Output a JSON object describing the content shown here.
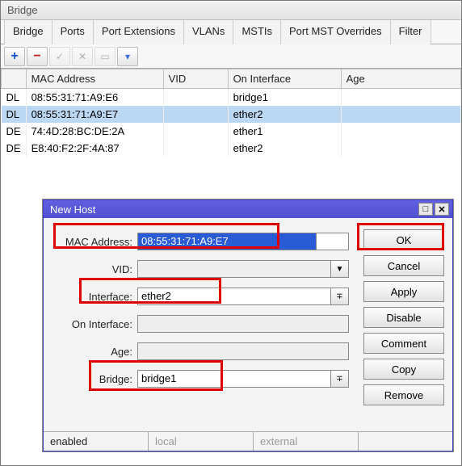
{
  "window": {
    "title": "Bridge"
  },
  "tabs": [
    "Bridge",
    "Ports",
    "Port Extensions",
    "VLANs",
    "MSTIs",
    "Port MST Overrides",
    "Filter"
  ],
  "columns": {
    "flag": "",
    "mac": "MAC Address",
    "vid": "VID",
    "oni": "On Interface",
    "age": "Age"
  },
  "rows": [
    {
      "flag": "DL",
      "mac": "08:55:31:71:A9:E6",
      "vid": "",
      "oni": "bridge1",
      "age": ""
    },
    {
      "flag": "DL",
      "mac": "08:55:31:71:A9:E7",
      "vid": "",
      "oni": "ether2",
      "age": ""
    },
    {
      "flag": "DE",
      "mac": "74:4D:28:BC:DE:2A",
      "vid": "",
      "oni": "ether1",
      "age": ""
    },
    {
      "flag": "DE",
      "mac": "E8:40:F2:2F:4A:87",
      "vid": "",
      "oni": "ether2",
      "age": ""
    }
  ],
  "dialog": {
    "title": "New Host",
    "fields": {
      "mac_label": "MAC Address:",
      "mac_value": "08:55:31:71:A9:E7",
      "vid_label": "VID:",
      "vid_value": "",
      "if_label": "Interface:",
      "if_value": "ether2",
      "oni_label": "On Interface:",
      "oni_value": "",
      "age_label": "Age:",
      "age_value": "",
      "br_label": "Bridge:",
      "br_value": "bridge1"
    },
    "buttons": {
      "ok": "OK",
      "cancel": "Cancel",
      "apply": "Apply",
      "disable": "Disable",
      "comment": "Comment",
      "copy": "Copy",
      "remove": "Remove"
    },
    "status": {
      "enabled": "enabled",
      "local": "local",
      "external": "external"
    }
  }
}
